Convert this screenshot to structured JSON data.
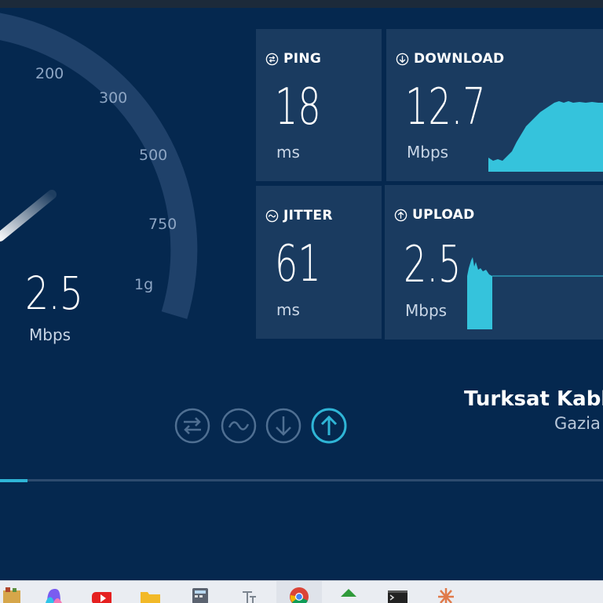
{
  "gauge": {
    "ticks": [
      "200",
      "300",
      "500",
      "750",
      "1g"
    ],
    "value": "2.5",
    "unit": "Mbps"
  },
  "ping": {
    "label": "PING",
    "value": "18",
    "unit": "ms",
    "icon": "ping-icon"
  },
  "download": {
    "label": "DOWNLOAD",
    "value": "12.7",
    "unit": "Mbps",
    "icon": "download-icon"
  },
  "jitter": {
    "label": "JITTER",
    "value": "61",
    "unit": "ms",
    "icon": "jitter-icon"
  },
  "upload": {
    "label": "UPLOAD",
    "value": "2.5",
    "unit": "Mbps",
    "icon": "upload-icon"
  },
  "provider": {
    "name": "Turksat Kablo",
    "location": "Gazia"
  },
  "steps": [
    "ping-step-icon",
    "jitter-step-icon",
    "download-step-icon",
    "upload-step-icon"
  ],
  "active_step": "upload",
  "progress": 0.045,
  "colors": {
    "background": "#05284f",
    "card": "#1a3b60",
    "accent": "#2fb5d6",
    "graph": "#35c3dc"
  },
  "taskbar_icons": [
    "file-explorer-icon",
    "copilot-icon",
    "youtube-icon",
    "folder-icon",
    "calculator-icon",
    "fonts-icon",
    "chrome-icon",
    "arrow-app-icon",
    "terminal-icon",
    "asterisk-app-icon"
  ]
}
